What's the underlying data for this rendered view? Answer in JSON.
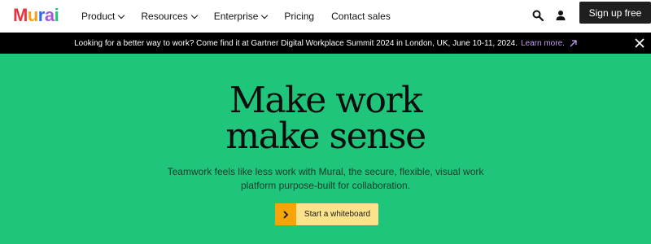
{
  "brand": {
    "logo_letters": [
      "M",
      "u",
      "r",
      "a",
      "i"
    ],
    "logo_colors": [
      "#e8343f",
      "#f5a21b",
      "#2c6cf2",
      "#a45bd8",
      "#1ec57a"
    ]
  },
  "nav": {
    "items": [
      {
        "label": "Product",
        "has_dropdown": true
      },
      {
        "label": "Resources",
        "has_dropdown": true
      },
      {
        "label": "Enterprise",
        "has_dropdown": true
      },
      {
        "label": "Pricing",
        "has_dropdown": false
      },
      {
        "label": "Contact sales",
        "has_dropdown": false
      }
    ],
    "search_icon": "search-icon",
    "account_icon": "user-icon",
    "signup_label": "Sign up free"
  },
  "banner": {
    "text": "Looking for a better way to work? Come find it at Gartner Digital Workplace Summit 2024 in London, UK, June 10-11, 2024.",
    "link_label": "Learn more.",
    "link_icon": "arrow-up-right-icon",
    "close_icon": "close-icon"
  },
  "hero": {
    "headline_line1": "Make work",
    "headline_line2": "make sense",
    "subtitle_line1": "Teamwork feels like less work with Mural, the secure, flexible, visual work",
    "subtitle_line2": "platform purpose-built for collaboration.",
    "cta_label": "Start a whiteboard",
    "cta_icon": "chevron-right-icon"
  },
  "colors": {
    "hero_bg": "#1ec57a",
    "banner_bg": "#000000",
    "banner_link": "#c19cf5",
    "signup_bg": "#1f1f1f",
    "cta_bg": "#fce28a",
    "cta_icon_bg": "#f6a40a"
  }
}
